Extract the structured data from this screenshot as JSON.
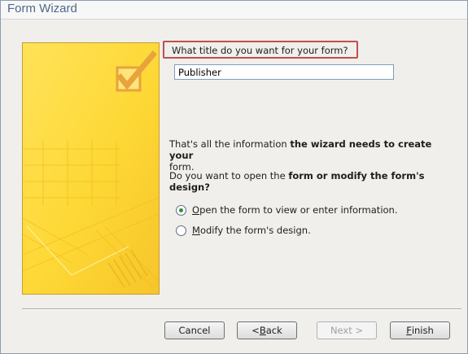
{
  "window": {
    "title": "Form Wizard"
  },
  "question": {
    "label": "What title do you want for your form?",
    "value": "Publisher"
  },
  "info": {
    "line1_pre": "That's all the information ",
    "line1_bold": "the wizard needs to create your",
    "line1_bold2": "form.",
    "line2_pre": "Do you want to open the ",
    "line2_bold": "form or modify the form's design?"
  },
  "options": {
    "open": {
      "mnemonic": "O",
      "rest": "pen the form to view or enter information.",
      "selected": true
    },
    "modify": {
      "mnemonic": "M",
      "rest": "odify the form's design.",
      "selected": false
    }
  },
  "buttons": {
    "cancel": "Cancel",
    "back_pre": "< ",
    "back_mn": "B",
    "back_rest": "ack",
    "next": "Next >",
    "finish_mn": "F",
    "finish_rest": "inish"
  },
  "colors": {
    "art_yellow": "#fdd835",
    "art_check": "#e8a33c",
    "highlight_border": "#c0504d"
  },
  "icons": {
    "art": "checkbox-check-icon"
  }
}
